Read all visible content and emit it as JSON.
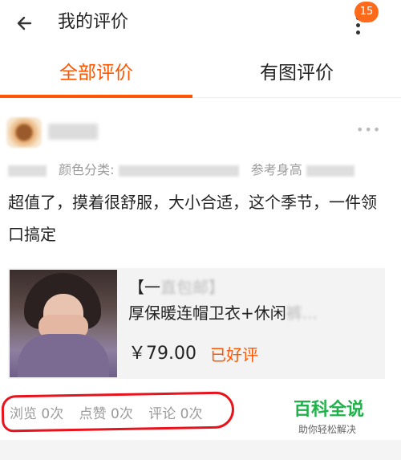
{
  "header": {
    "title": "我的评价",
    "back_icon": "arrow-left-icon",
    "menu_icon": "vertical-dots-icon",
    "badge_count": "15",
    "badge_color": "#ff6a1a"
  },
  "tabs": [
    {
      "label": "全部评价",
      "active": true
    },
    {
      "label": "有图评价",
      "active": false
    }
  ],
  "accent_color": "#ff5500",
  "review": {
    "sku_label": "颜色分类:",
    "sku_extra": "参考身高",
    "text": "超值了，摸着很舒服，大小合适，这个季节，一件领口搞定",
    "more_icon": "horizontal-dots-icon"
  },
  "product": {
    "title_visible": "【一",
    "title_rest_blurred": "直包邮】",
    "title_line2": "厚保暖连帽卫衣+休闲",
    "title_line2_tail": "裤...",
    "price": "￥79.00",
    "rating": "已好评"
  },
  "stats": {
    "views": "浏览 0次",
    "likes": "点赞 0次",
    "comments": "评论 0次"
  },
  "watermark": {
    "main": "百科全说",
    "sub": "助你轻松解决"
  }
}
